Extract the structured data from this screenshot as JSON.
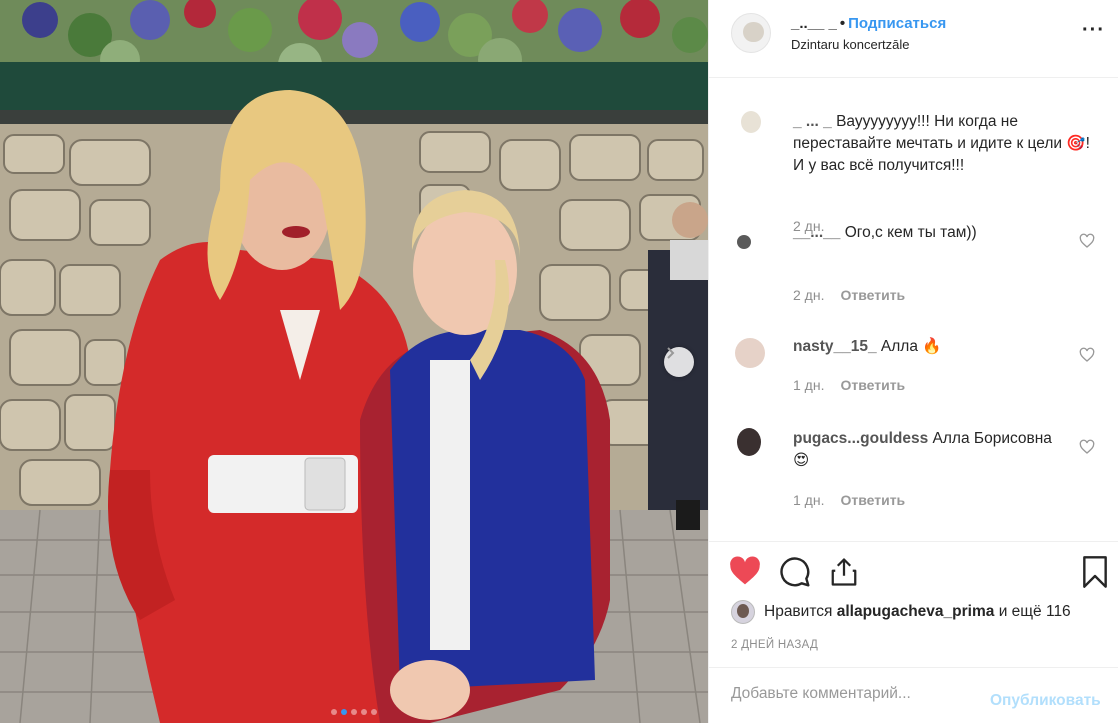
{
  "header": {
    "username": "_..__ _",
    "separator": "•",
    "follow_label": "Подписаться",
    "location": "Dzintaru koncertzāle",
    "more_icon": "more-horizontal-icon"
  },
  "comments": [
    {
      "user": "_ ... _",
      "text": "Вауууууууу!!! Ни когда не переставайте мечтать и идите к цели 🎯! И у вас всё получится!!!",
      "age": "2 дн.",
      "reply": ""
    },
    {
      "user": "__...__",
      "text": "Ого,с кем ты там))",
      "age": "2 дн.",
      "reply": "Ответить"
    },
    {
      "user": "nasty__15_",
      "text": "Алла 🔥",
      "age": "1 дн.",
      "reply": "Ответить"
    },
    {
      "user": "pugacs...gouldess",
      "text": "Алла Борисовна 😍",
      "age": "1 дн.",
      "reply": "Ответить"
    }
  ],
  "actions": {
    "like_icon": "heart-filled-icon",
    "comment_icon": "comment-icon",
    "share_icon": "share-icon",
    "save_icon": "bookmark-icon",
    "like_color": "#ed4956"
  },
  "likes": {
    "prefix": "Нравится",
    "user": "allapugacheva_prima",
    "suffix": "и ещё 116"
  },
  "time_label": "2 ДНЕЙ НАЗАД",
  "add_comment": {
    "placeholder": "Добавьте комментарий...",
    "post_label": "Опубликовать"
  },
  "carousel": {
    "total": 5,
    "active_index": 1,
    "next_icon": "chevron-right-icon"
  }
}
